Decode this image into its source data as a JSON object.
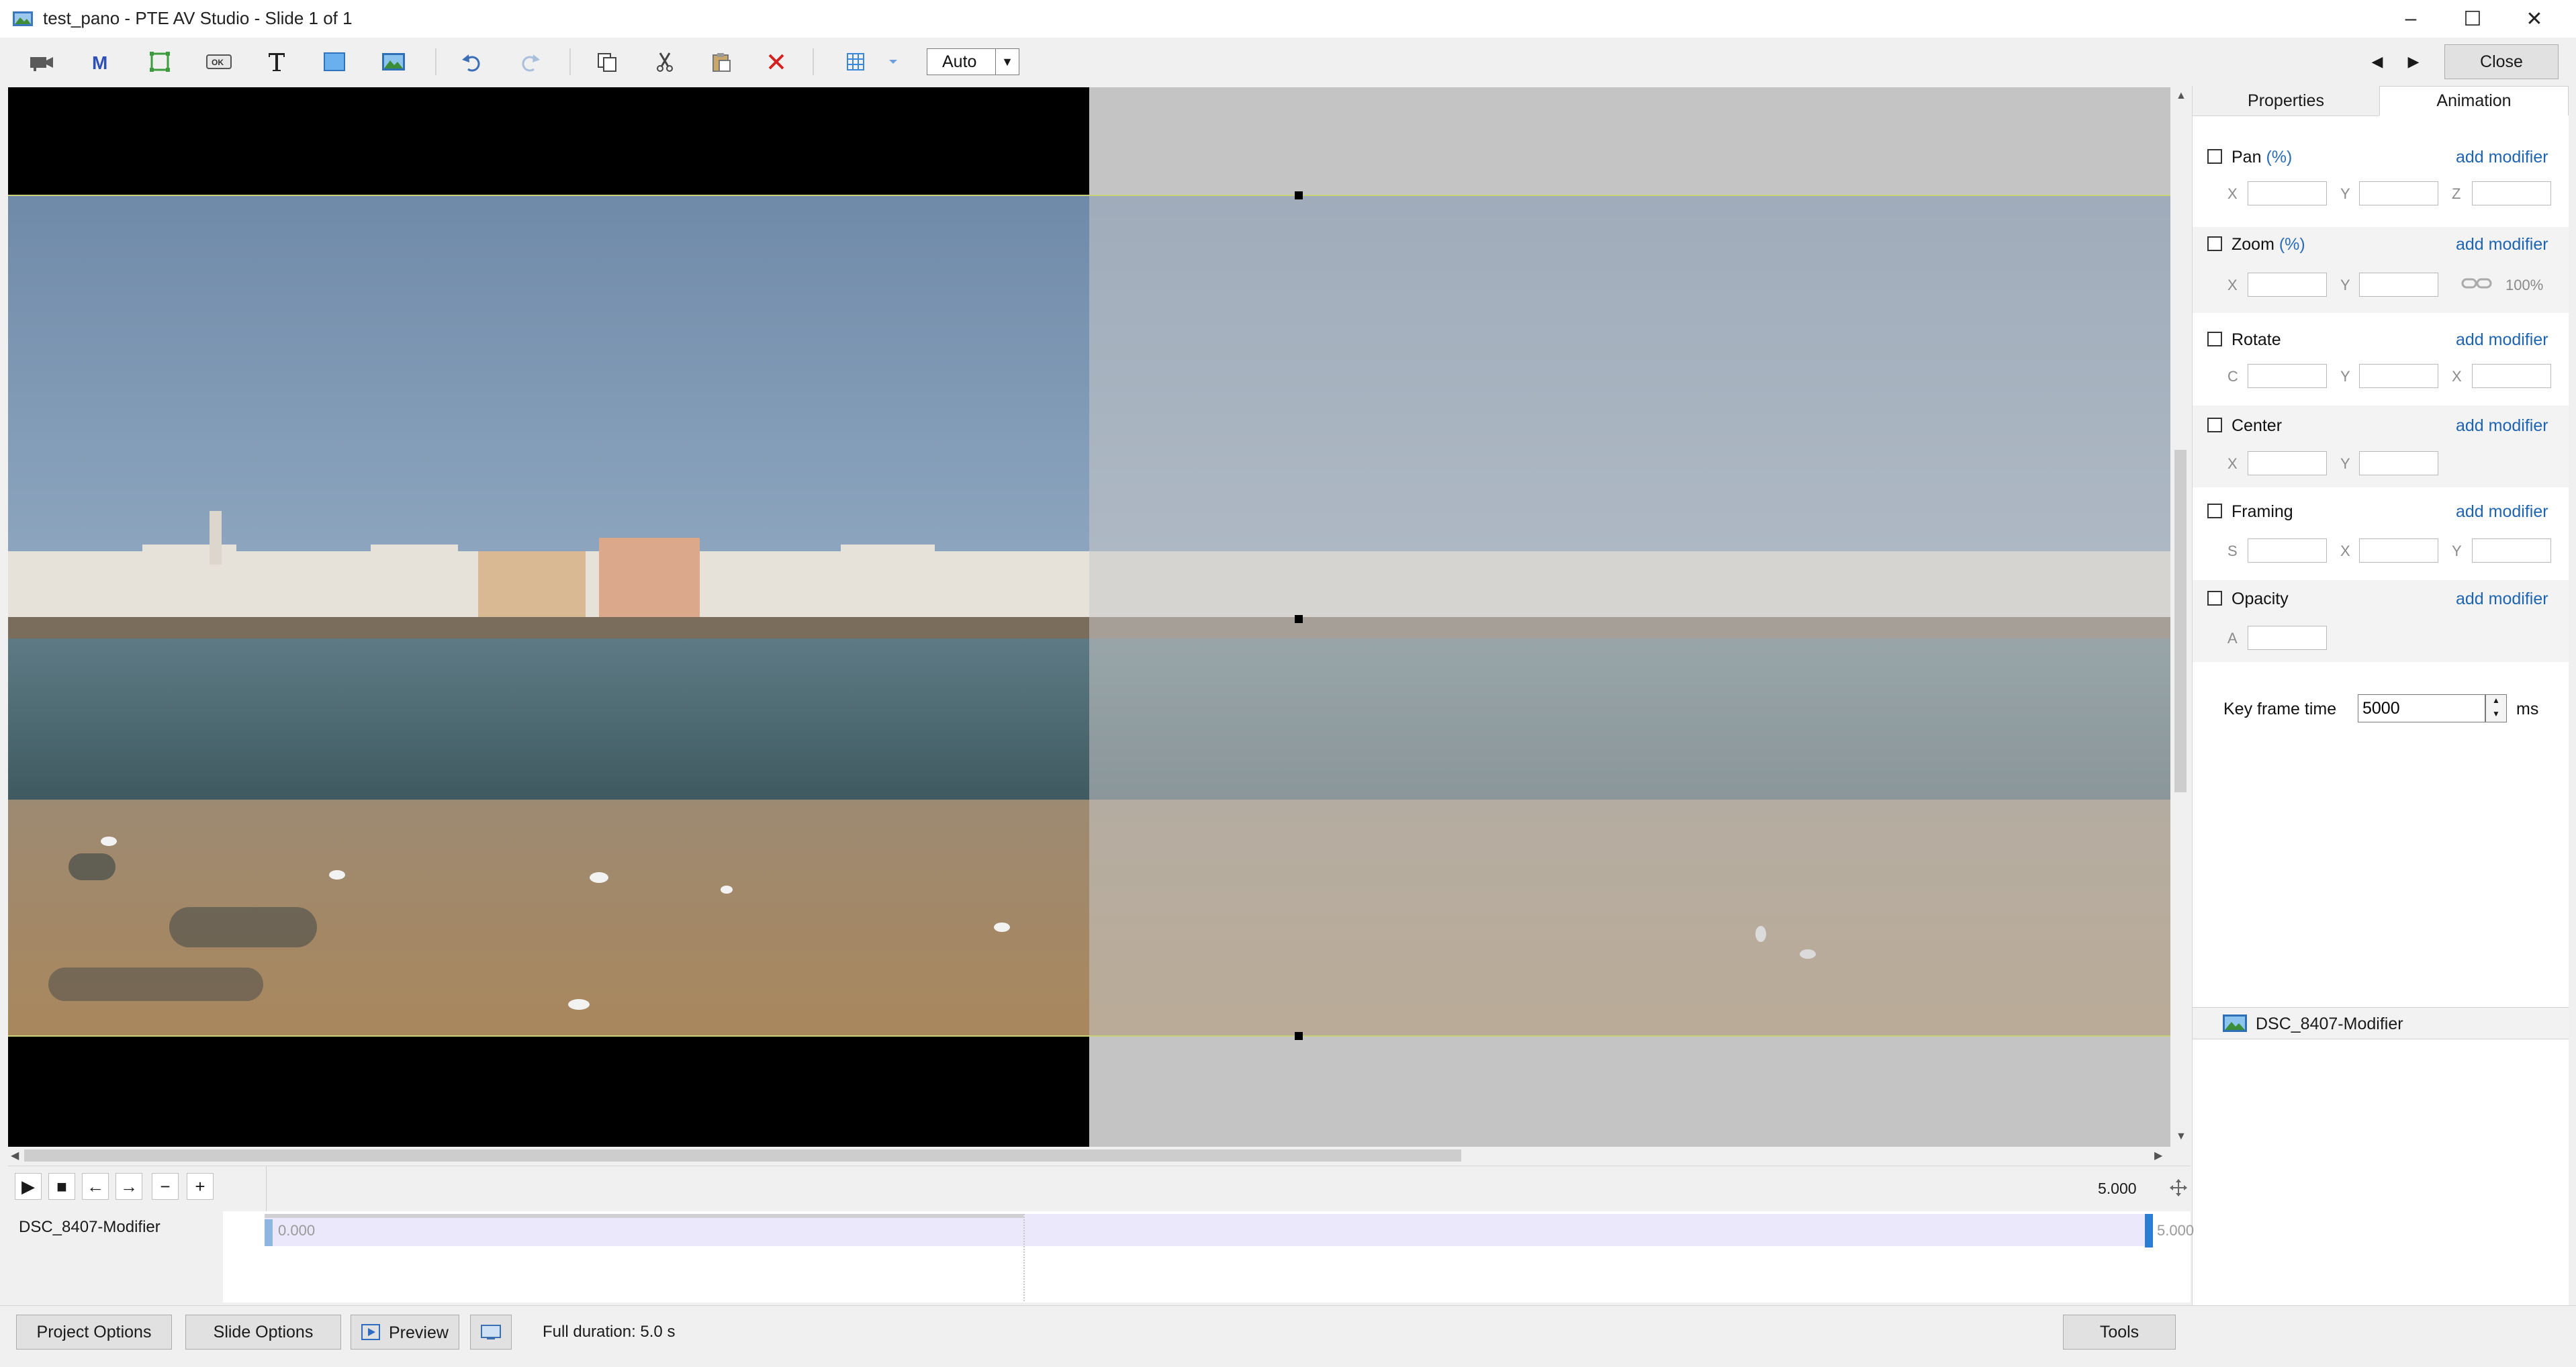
{
  "window": {
    "title": "test_pano - PTE AV Studio - Slide 1 of 1",
    "minimize": "–",
    "maximize": "☐",
    "close": "✕"
  },
  "toolbar": {
    "zoom_value": "Auto",
    "close_label": "Close",
    "prev_arrow": "◀",
    "next_arrow": "▶",
    "icons": [
      "camera-icon",
      "mask-icon",
      "frame-icon",
      "button-icon",
      "text-icon",
      "rectangle-icon",
      "image-icon",
      "undo-icon",
      "redo-icon",
      "copy-icon",
      "cut-icon",
      "paste-icon",
      "delete-icon",
      "grid-icon",
      "grid-dropdown-icon"
    ]
  },
  "panel": {
    "tabs": [
      "Properties",
      "Animation"
    ],
    "sections": [
      {
        "label": "Pan",
        "unit": "(%)",
        "link": "add modifier",
        "fields": [
          "X",
          "Y",
          "Z"
        ]
      },
      {
        "label": "Zoom",
        "unit": "(%)",
        "link": "add modifier",
        "fields": [
          "X",
          "Y"
        ],
        "extra": "100%"
      },
      {
        "label": "Rotate",
        "unit": "",
        "link": "add modifier",
        "fields": [
          "C",
          "Y",
          "X"
        ]
      },
      {
        "label": "Center",
        "unit": "",
        "link": "add modifier",
        "fields": [
          "X",
          "Y"
        ]
      },
      {
        "label": "Framing",
        "unit": "",
        "link": "add modifier",
        "fields": [
          "S",
          "X",
          "Y"
        ]
      },
      {
        "label": "Opacity",
        "unit": "",
        "link": "add modifier",
        "fields": [
          "A"
        ]
      }
    ],
    "keyframe": {
      "label": "Key frame time",
      "value": "5000",
      "unit": "ms"
    },
    "object_name": "DSC_8407-Modifier"
  },
  "timeline": {
    "ruler_end": "5.000",
    "track_name": "DSC_8407-Modifier",
    "start_time": "0.000",
    "end_time": "5.000",
    "buttons": [
      "▶",
      "■",
      "←",
      "→",
      "−",
      "+"
    ]
  },
  "bottom": {
    "project_options": "Project Options",
    "slide_options": "Slide Options",
    "preview": "Preview",
    "full_duration": "Full duration: 5.0 s",
    "tools": "Tools"
  },
  "colors": {
    "accent": "#1e64b0",
    "timeline_marker": "#2b7cd3",
    "guide": "#c9d27a",
    "sky": "#6f8cab",
    "water": "#4e6b73",
    "beach": "#a98c66"
  }
}
